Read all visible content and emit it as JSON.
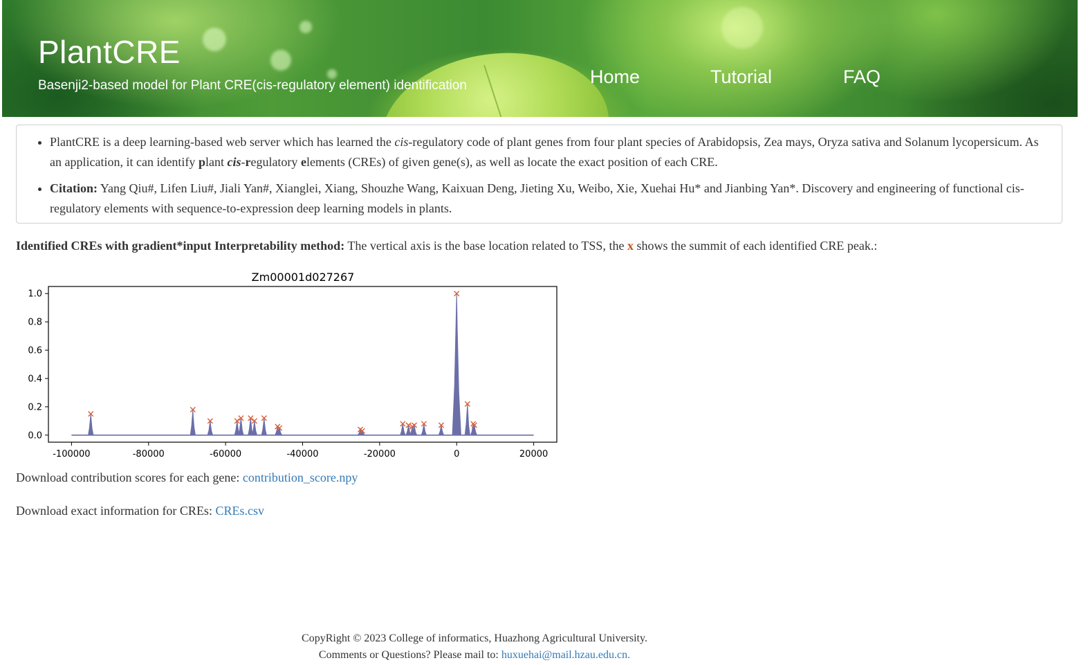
{
  "header": {
    "title": "PlantCRE",
    "subtitle": "Basenji2-based model for Plant CRE(cis-regulatory element) identification",
    "nav": [
      {
        "label": "Home"
      },
      {
        "label": "Tutorial"
      },
      {
        "label": "FAQ"
      }
    ]
  },
  "intro": {
    "item1": {
      "t1": "PlantCRE is a deep learning-based web server which has learned the ",
      "t2": "cis",
      "t3": "-regulatory code of plant genes from four plant species of Arabidopsis, Zea mays, Oryza sativa and Solanum lycopersicum. As an application, it can identify ",
      "t4": "p",
      "t5": "lant ",
      "t6": "cis",
      "t7": "-",
      "t8": "r",
      "t9": "egulatory ",
      "t10": "e",
      "t11": "lements (CREs) of given gene(s), as well as locate the exact position of each CRE."
    },
    "item2": {
      "label": "Citation:",
      "text": " Yang Qiu#, Lifen Liu#, Jiali Yan#, Xianglei, Xiang, Shouzhe Wang, Kaixuan Deng, Jieting Xu, Weibo, Xie, Xuehai Hu* and Jianbing Yan*. Discovery and engineering of functional cis-regulatory elements with sequence-to-expression deep learning models in plants."
    }
  },
  "result": {
    "label": "Identified CREs with gradient*input Interpretability method:",
    "text_before": " The vertical axis is the base location related to TSS, the ",
    "mark": "x",
    "text_after": " shows the summit of each identified CRE peak.:"
  },
  "chart_data": {
    "type": "area",
    "title": "Zm00001d027267",
    "xlabel": "",
    "ylabel": "",
    "xlim": [
      -106000,
      26000
    ],
    "ylim": [
      -0.05,
      1.05
    ],
    "xticks": [
      -100000,
      -80000,
      -60000,
      -40000,
      -20000,
      0,
      20000
    ],
    "yticks": [
      0.0,
      0.2,
      0.4,
      0.6,
      0.8,
      1.0
    ],
    "xtick_labels": [
      "-100000",
      "-80000",
      "-60000",
      "-40000",
      "-20000",
      "0",
      "20000"
    ],
    "ytick_labels": [
      "0.0",
      "0.2",
      "0.4",
      "0.6",
      "0.8",
      "1.0"
    ],
    "x_range": [
      -100000,
      20000
    ],
    "line_color": "#6b6fa8",
    "marker_color": "#d9603b",
    "peaks": [
      {
        "x": -95000,
        "y": 0.15
      },
      {
        "x": -68500,
        "y": 0.18
      },
      {
        "x": -64000,
        "y": 0.1
      },
      {
        "x": -57000,
        "y": 0.1
      },
      {
        "x": -56000,
        "y": 0.12
      },
      {
        "x": -53500,
        "y": 0.12
      },
      {
        "x": -52500,
        "y": 0.1
      },
      {
        "x": -50000,
        "y": 0.12
      },
      {
        "x": -46500,
        "y": 0.06
      },
      {
        "x": -46000,
        "y": 0.05
      },
      {
        "x": -25000,
        "y": 0.04
      },
      {
        "x": -24500,
        "y": 0.03
      },
      {
        "x": -14000,
        "y": 0.08
      },
      {
        "x": -12500,
        "y": 0.07
      },
      {
        "x": -11500,
        "y": 0.06
      },
      {
        "x": -11000,
        "y": 0.07
      },
      {
        "x": -8500,
        "y": 0.08
      },
      {
        "x": -4000,
        "y": 0.07
      },
      {
        "x": 0,
        "y": 1.0
      },
      {
        "x": 2800,
        "y": 0.22
      },
      {
        "x": 4300,
        "y": 0.08
      },
      {
        "x": 4600,
        "y": 0.07
      }
    ]
  },
  "downloads": {
    "scores_label": "Download contribution scores for each gene: ",
    "scores_link": "contribution_score.npy",
    "cres_label": "Download exact information for CREs: ",
    "cres_link": "CREs.csv"
  },
  "footer": {
    "copyright": "CopyRight © 2023 College of informatics, Huazhong Agricultural University.",
    "contact_label": "Comments or Questions? Please mail to: ",
    "email": "huxuehai@mail.hzau.edu.cn."
  }
}
